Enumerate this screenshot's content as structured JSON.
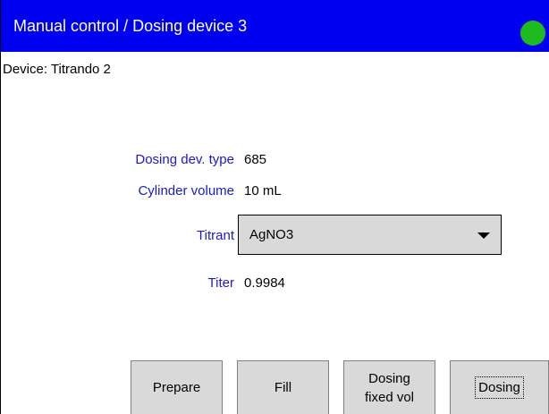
{
  "titlebar": {
    "title": "Manual control / Dosing device 3",
    "status_color": "#1fba1f"
  },
  "device_label": "Device: Titrando 2",
  "fields": {
    "dosing_dev_type": {
      "label": "Dosing dev. type",
      "value": "685"
    },
    "cylinder_volume": {
      "label": "Cylinder volume",
      "value": "10 mL"
    },
    "titrant": {
      "label": "Titrant",
      "value": "AgNO3"
    },
    "titer": {
      "label": "Titer",
      "value": "0.9984"
    }
  },
  "buttons": {
    "prepare": "Prepare",
    "fill": "Fill",
    "dosing_fixed_vol_line1": "Dosing",
    "dosing_fixed_vol_line2": "fixed vol",
    "dosing": "Dosing"
  }
}
